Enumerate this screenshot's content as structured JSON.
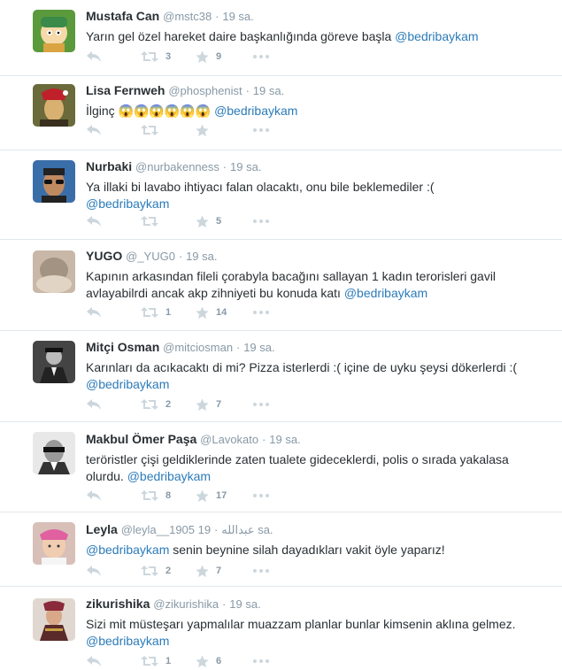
{
  "tweets": [
    {
      "name": "Mustafa Can",
      "username": "@mstc38",
      "dot": "·",
      "time": "19 sa.",
      "text_before": "Yarın gel özel hareket daire başkanlığında göreve başla ",
      "mention": "@bedribaykam",
      "text_after": "",
      "retweets": "3",
      "favorites": "9",
      "avatar_icon": "cartoon-avatar-icon"
    },
    {
      "name": "Lisa Fernweh",
      "username": "@phosphenist",
      "dot": "·",
      "time": "19 sa.",
      "text_before": "İlginç 😱😱😱😱😱😱 ",
      "mention": "@bedribaykam",
      "text_after": "",
      "retweets": "",
      "favorites": "",
      "avatar_icon": "portrait-avatar-icon"
    },
    {
      "name": "Nurbaki",
      "username": "@nurbakenness",
      "dot": "·",
      "time": "19 sa.",
      "text_before": "Ya illaki bi lavabo ihtiyacı falan olacaktı, onu bile beklemediler :(\n",
      "mention": "@bedribaykam",
      "text_after": "",
      "retweets": "",
      "favorites": "5",
      "avatar_icon": "sunglasses-avatar-icon"
    },
    {
      "name": "YUGO",
      "username": "@_YUG0",
      "dot": "·",
      "time": "19 sa.",
      "text_before": "Kapının arkasından fileli çorabyla bacağını sallayan 1 kadın terorisleri gavil\navlayabilrdi ancak akp zihniyeti bu konuda katı ",
      "mention": "@bedribaykam",
      "text_after": "",
      "retweets": "1",
      "favorites": "14",
      "avatar_icon": "blurred-avatar-icon"
    },
    {
      "name": "Mitçi Osman",
      "username": "@mitciosman",
      "dot": "·",
      "time": "19 sa.",
      "text_before": "Karınları da acıkacaktı di mi? Pizza isterlerdi :( içine de uyku şeysi dökerlerdi :(\n",
      "mention": "@bedribaykam",
      "text_after": "",
      "retweets": "2",
      "favorites": "7",
      "avatar_icon": "bw-portrait-avatar-icon"
    },
    {
      "name": "Makbul Ömer Paşa",
      "username": "@Lavokato",
      "dot": "·",
      "time": "19 sa.",
      "text_before": "teröristler çişi geldiklerinde zaten tualete gideceklerdi, polis o sırada yakalasa\nolurdu. ",
      "mention": "@bedribaykam",
      "text_after": "",
      "retweets": "8",
      "favorites": "17",
      "avatar_icon": "masked-avatar-icon"
    },
    {
      "name": "Leyla",
      "username": "@leyla__1905 عبدالله",
      "dot": "·",
      "time": "19 sa.",
      "text_before": "",
      "mention": "@bedribaykam",
      "text_after": " senin beynine silah dayadıkları vakit öyle yaparız!",
      "retweets": "2",
      "favorites": "7",
      "avatar_icon": "child-avatar-icon"
    },
    {
      "name": "zikurishika",
      "username": "@zikurishika",
      "dot": "·",
      "time": "19 sa.",
      "text_before": "Sizi mit müsteşarı yapmalılar muazzam planlar bunlar kimsenin aklına gelmez.\n",
      "mention": "@bedribaykam",
      "text_after": "",
      "retweets": "1",
      "favorites": "6",
      "avatar_icon": "costume-avatar-icon"
    }
  ]
}
